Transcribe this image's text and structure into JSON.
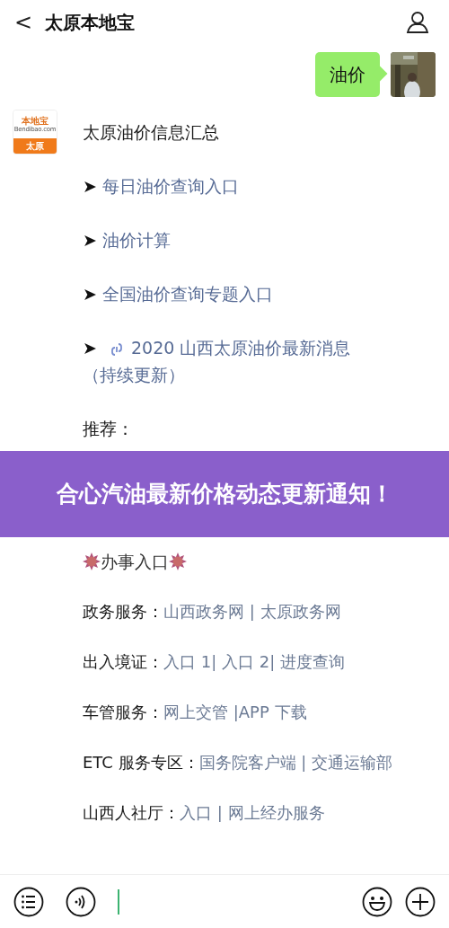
{
  "header": {
    "back": "<",
    "title": "太原本地宝"
  },
  "user_message": {
    "text": "油价"
  },
  "bot": {
    "logo": {
      "top": "本地宝",
      "domain": "Bendibao.com",
      "city": "太原"
    },
    "items": [
      {
        "kind": "heading",
        "text": "太原油价信息汇总"
      },
      {
        "kind": "arrow_link",
        "arrow": "➤",
        "link": "每日油价查询入口",
        "has_link_icon": false
      },
      {
        "kind": "arrow_link",
        "arrow": "➤",
        "link": "油价计算",
        "has_link_icon": false
      },
      {
        "kind": "arrow_link",
        "arrow": "➤",
        "link": "全国油价查询专题入口",
        "has_link_icon": false
      },
      {
        "kind": "arrow_link",
        "arrow": "➤",
        "link": "2020 山西太原油价最新消息（持续更新）",
        "has_link_icon": true
      },
      {
        "kind": "plain",
        "text": "推荐："
      }
    ],
    "items_below_banner": [
      {
        "kind": "sun_title",
        "text": "办事入口"
      },
      {
        "kind": "service",
        "label": "政务服务：",
        "links": "山西政务网 | 太原政务网"
      },
      {
        "kind": "service",
        "label": "出入境证：",
        "links": "入口 1| 入口 2| 进度查询"
      },
      {
        "kind": "service",
        "label": "车管服务：",
        "links": "网上交管 |APP 下载"
      },
      {
        "kind": "service",
        "label": "ETC 服务专区：",
        "links": "国务院客户端 | 交通运输部"
      },
      {
        "kind": "service",
        "label": "山西人社厅：",
        "links": "入口 | 网上经办服务"
      }
    ]
  },
  "banner": {
    "text": "合心汽油最新价格动态更新通知！"
  }
}
